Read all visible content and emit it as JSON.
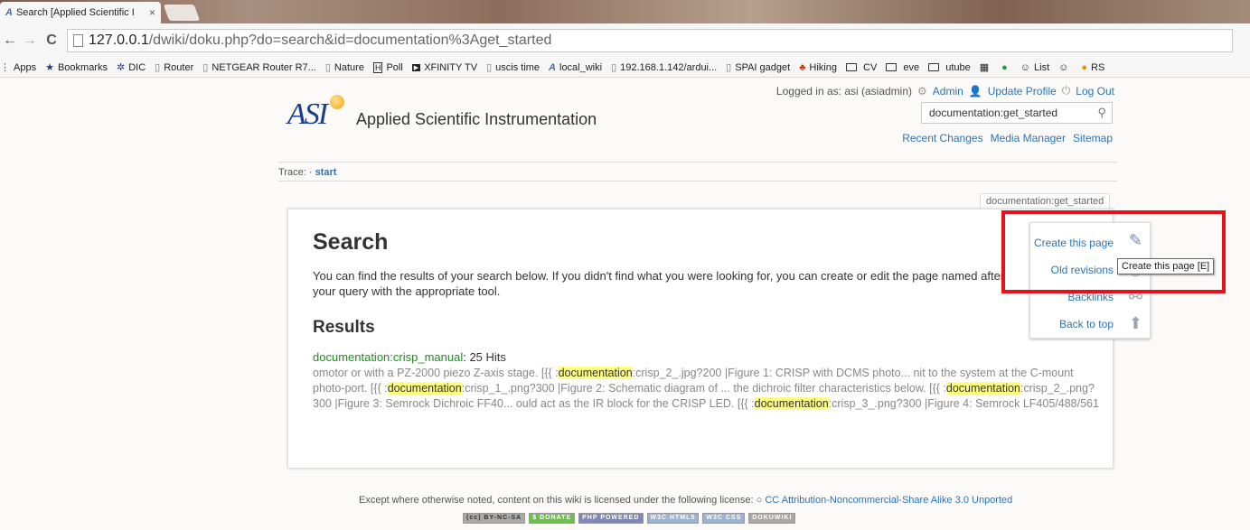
{
  "browser": {
    "tab_title": "Search [Applied Scientific I",
    "tab_close": "×",
    "url_host": "127.0.0.1",
    "url_path": "/dwiki/doku.php?do=search&id=documentation%3Aget_started",
    "bookmarks": [
      "Apps",
      "Bookmarks",
      "DIC",
      "Router",
      "NETGEAR Router R7...",
      "Nature",
      "Poll",
      "XFINITY TV",
      "uscis time",
      "local_wiki",
      "192.168.1.142/ardui...",
      "SPAI gadget",
      "Hiking",
      "CV",
      "eve",
      "utube",
      "List",
      "RS"
    ]
  },
  "user": {
    "logged_in": "Logged in as: asi (asiadmin)",
    "admin": "Admin",
    "update_profile": "Update Profile",
    "logout": "Log Out"
  },
  "site": {
    "logo_text": "ASI",
    "name": "Applied Scientific Instrumentation",
    "search_value": "documentation:get_started",
    "tools": [
      "Recent Changes",
      "Media Manager",
      "Sitemap"
    ]
  },
  "trace": {
    "label": "Trace: ·",
    "start": "start"
  },
  "page_id": "documentation:get_started",
  "content": {
    "title": "Search",
    "intro": "You can find the results of your search below. If you didn't find what you were looking for, you can create or edit the page named after your query with the appropriate tool.",
    "results_heading": "Results",
    "hit_link": "documentation:crisp_manual",
    "hit_count": ": 25 Hits",
    "snippet": {
      "s1": "omotor or with a PZ-2000 piezo Z-axis stage. [{{ :",
      "m": "documentation",
      "s2": ":crisp_2_.jpg?200 |Figure 1: CRISP with DCMS photo... nit to the system at the C-mount photo-port. [{{ :",
      "s3": ":crisp_1_.png?300 |Figure 2: Schematic diagram of ... the dichroic filter characteristics below. [{{ :",
      "s4": ":crisp_2_.png?300 |Figure 3: Semrock Dichroic FF40... ould act as the IR block for the CRISP LED. [{{ :",
      "s5": ":crisp_3_.png?300 |Figure 4: Semrock LF405/488/561"
    }
  },
  "pagetools": {
    "create": "Create this page",
    "old": "Old revisions",
    "backlinks": "Backlinks",
    "top": "Back to top",
    "tooltip": "Create this page [E]"
  },
  "footer": {
    "text": "Except where otherwise noted, content on this wiki is licensed under the following license:",
    "license": "CC Attribution-Noncommercial-Share Alike 3.0 Unported",
    "badges": [
      "(cc) BY-NC-SA",
      "$ DONATE",
      "PHP POWERED",
      "W3C HTML5",
      "W3C CSS",
      "DOKUWIKI"
    ]
  }
}
